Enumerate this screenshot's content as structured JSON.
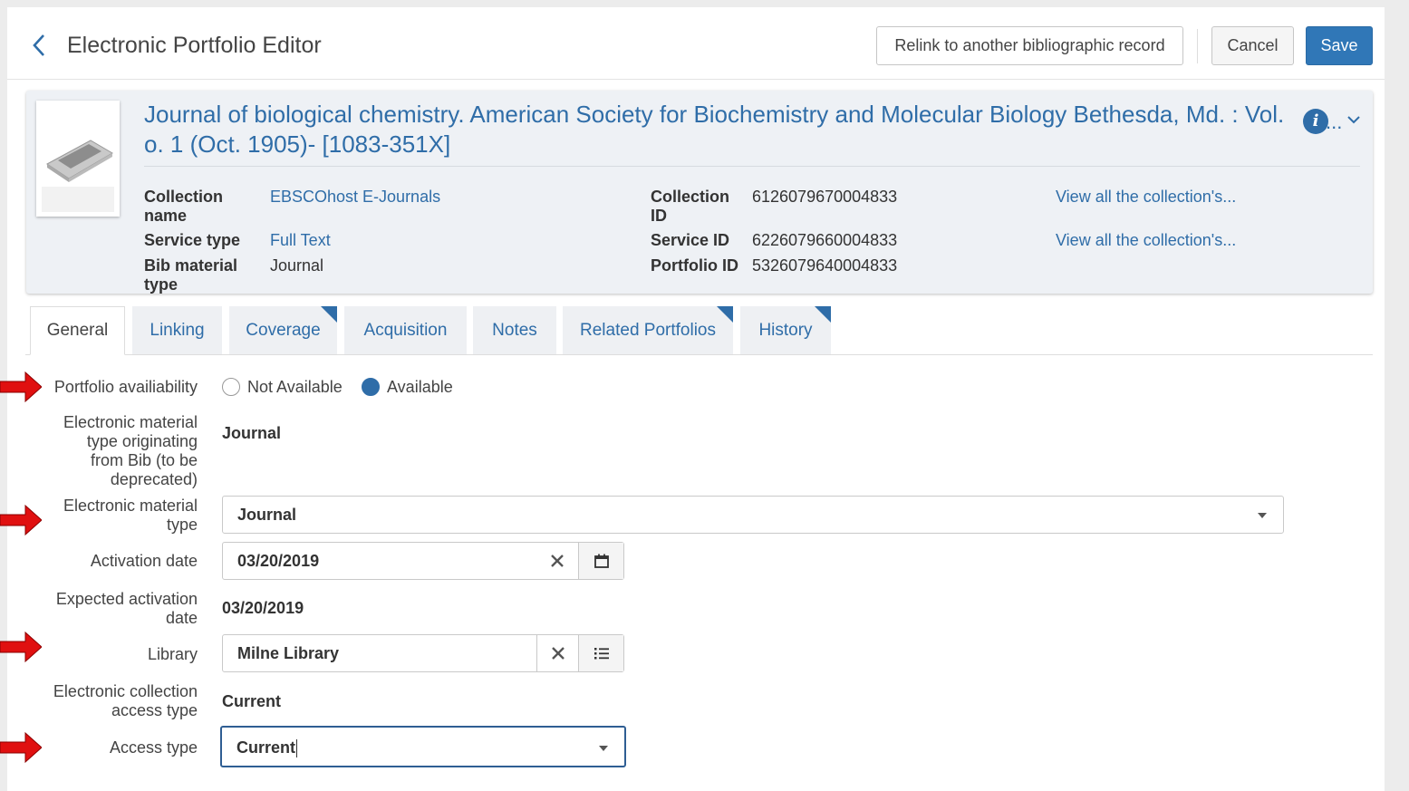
{
  "header": {
    "title": "Electronic Portfolio Editor",
    "relink_label": "Relink to another bibliographic record",
    "cancel_label": "Cancel",
    "save_label": "Save"
  },
  "record": {
    "title_line1": "Journal of biological chemistry. American Society for Biochemistry and Molecular Biology Bethesda, Md. : Vol.",
    "title_line2": "o. 1 (Oct. 1905)- [1083-351X]",
    "ellipsis": "...",
    "info_icon_glyph": "i",
    "fields": {
      "collection_name_label_1": "Collection",
      "collection_name_label_2": "name",
      "collection_name_value": "EBSCOhost E-Journals",
      "service_type_label": "Service type",
      "service_type_value": "Full Text",
      "bib_material_label_1": "Bib material",
      "bib_material_label_2": "type",
      "bib_material_value": "Journal",
      "collection_id_label_1": "Collection",
      "collection_id_label_2": "ID",
      "collection_id_value": "6126079670004833",
      "service_id_label": "Service ID",
      "service_id_value": "6226079660004833",
      "portfolio_id_label": "Portfolio ID",
      "portfolio_id_value": "5326079640004833",
      "view_collection_link_1": "View all the collection's...",
      "view_collection_link_2": "View all the collection's..."
    }
  },
  "tabs": [
    {
      "label": "General",
      "active": true
    },
    {
      "label": "Linking"
    },
    {
      "label": "Coverage",
      "flag": true
    },
    {
      "label": "Acquisition"
    },
    {
      "label": "Notes"
    },
    {
      "label": "Related Portfolios",
      "flag": true
    },
    {
      "label": "History",
      "flag": true
    }
  ],
  "form": {
    "availability_label": "Portfolio availiability",
    "not_available_label": "Not Available",
    "available_label": "Available",
    "selected_availability": "Available",
    "emt_bib_label_1": "Electronic material",
    "emt_bib_label_2": "type originating",
    "emt_bib_label_3": "from Bib (to be",
    "emt_bib_label_4": "deprecated)",
    "emt_bib_value": "Journal",
    "emt_label_1": "Electronic material",
    "emt_label_2": "type",
    "emt_value": "Journal",
    "activation_date_label": "Activation date",
    "activation_date_value": "03/20/2019",
    "expected_activation_label_1": "Expected activation",
    "expected_activation_label_2": "date",
    "expected_activation_value": "03/20/2019",
    "library_label": "Library",
    "library_value": "Milne Library",
    "ec_access_label_1": "Electronic collection",
    "ec_access_label_2": "access type",
    "ec_access_value": "Current",
    "access_type_label": "Access type",
    "access_type_value": "Current"
  },
  "colors": {
    "accent": "#2f6da8",
    "save_button": "#3077b7",
    "annotation_arrow": "#e01010"
  },
  "icons": [
    "back-chevron-icon",
    "info-icon",
    "chevron-down-icon",
    "clear-icon",
    "calendar-icon",
    "list-icon",
    "dropdown-caret-icon",
    "red-arrow-icon"
  ]
}
